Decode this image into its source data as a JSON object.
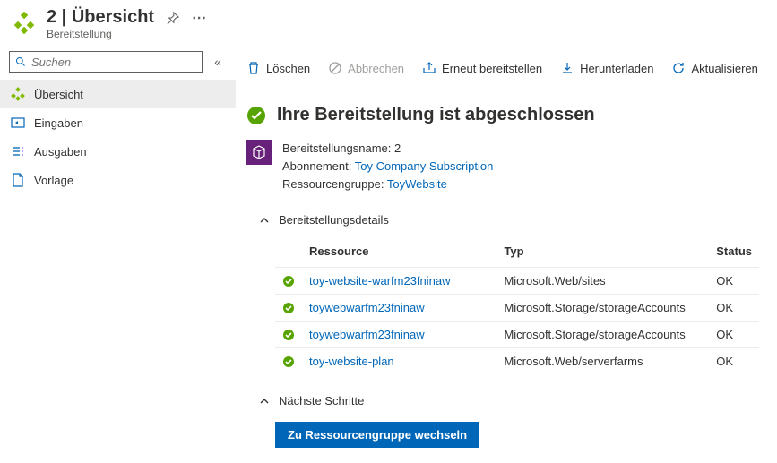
{
  "header": {
    "title": "2 | Übersicht",
    "subtitle": "Bereitstellung"
  },
  "sidebar": {
    "search_placeholder": "Suchen",
    "items": [
      {
        "label": "Übersicht"
      },
      {
        "label": "Eingaben"
      },
      {
        "label": "Ausgaben"
      },
      {
        "label": "Vorlage"
      }
    ]
  },
  "toolbar": {
    "delete": "Löschen",
    "cancel": "Abbrechen",
    "redeploy": "Erneut bereitstellen",
    "download": "Herunterladen",
    "refresh": "Aktualisieren"
  },
  "status": {
    "title": "Ihre Bereitstellung ist abgeschlossen"
  },
  "meta": {
    "name_label": "Bereitstellungsname:",
    "name_value": "2",
    "sub_label": "Abonnement:",
    "sub_value": "Toy Company Subscription",
    "rg_label": "Ressourcengruppe:",
    "rg_value": "ToyWebsite"
  },
  "details": {
    "header": "Bereitstellungsdetails",
    "columns": {
      "resource": "Ressource",
      "type": "Typ",
      "status": "Status"
    },
    "rows": [
      {
        "resource": "toy-website-warfm23fninaw",
        "type": "Microsoft.Web/sites",
        "status": "OK"
      },
      {
        "resource": "toywebwarfm23fninaw",
        "type": "Microsoft.Storage/storageAccounts",
        "status": "OK"
      },
      {
        "resource": "toywebwarfm23fninaw",
        "type": "Microsoft.Storage/storageAccounts",
        "status": "OK"
      },
      {
        "resource": "toy-website-plan",
        "type": "Microsoft.Web/serverfarms",
        "status": "OK"
      }
    ]
  },
  "next": {
    "header": "Nächste Schritte",
    "action": "Zu Ressourcengruppe wechseln"
  }
}
